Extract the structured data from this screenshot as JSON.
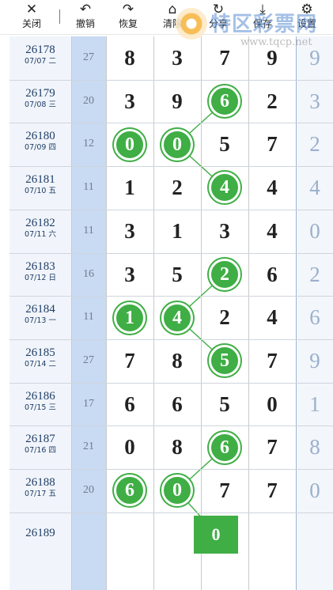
{
  "toolbar": {
    "close": "关闭",
    "undo": "撤销",
    "redo": "恢复",
    "clear": "清除",
    "share": "分享",
    "save": "保存",
    "settings": "设置"
  },
  "watermark": {
    "brand": "特区彩票网",
    "url": "www.tqcp.net"
  },
  "rows": [
    {
      "issue": "26178",
      "date": "07/07 二",
      "sum": "27",
      "digits": [
        "8",
        "3",
        "7",
        "9"
      ],
      "last": "9",
      "hits": []
    },
    {
      "issue": "26179",
      "date": "07/08 三",
      "sum": "20",
      "digits": [
        "3",
        "9",
        "6",
        "2"
      ],
      "last": "3",
      "hits": [
        2
      ]
    },
    {
      "issue": "26180",
      "date": "07/09 四",
      "sum": "12",
      "digits": [
        "0",
        "0",
        "5",
        "7"
      ],
      "last": "2",
      "hits": [
        0,
        1
      ]
    },
    {
      "issue": "26181",
      "date": "07/10 五",
      "sum": "11",
      "digits": [
        "1",
        "2",
        "4",
        "4"
      ],
      "last": "4",
      "hits": [
        2
      ]
    },
    {
      "issue": "26182",
      "date": "07/11 六",
      "sum": "11",
      "digits": [
        "3",
        "1",
        "3",
        "4"
      ],
      "last": "0",
      "hits": []
    },
    {
      "issue": "26183",
      "date": "07/12 日",
      "sum": "16",
      "digits": [
        "3",
        "5",
        "2",
        "6"
      ],
      "last": "2",
      "hits": [
        2
      ]
    },
    {
      "issue": "26184",
      "date": "07/13 一",
      "sum": "11",
      "digits": [
        "1",
        "4",
        "2",
        "4"
      ],
      "last": "6",
      "hits": [
        0,
        1
      ]
    },
    {
      "issue": "26185",
      "date": "07/14 二",
      "sum": "27",
      "digits": [
        "7",
        "8",
        "5",
        "7"
      ],
      "last": "9",
      "hits": [
        2
      ]
    },
    {
      "issue": "26186",
      "date": "07/15 三",
      "sum": "17",
      "digits": [
        "6",
        "6",
        "5",
        "0"
      ],
      "last": "1",
      "hits": []
    },
    {
      "issue": "26187",
      "date": "07/16 四",
      "sum": "21",
      "digits": [
        "0",
        "8",
        "6",
        "7"
      ],
      "last": "8",
      "hits": [
        2
      ]
    },
    {
      "issue": "26188",
      "date": "07/17 五",
      "sum": "20",
      "digits": [
        "6",
        "0",
        "7",
        "7"
      ],
      "last": "0",
      "hits": [
        0,
        1
      ]
    }
  ],
  "pending": {
    "issue": "26189",
    "value": "0"
  },
  "colors": {
    "ball": "#3fae45",
    "sum_col": "#c9daf3",
    "issue_text": "#1f3d66",
    "last_col_text": "#9ab0cb"
  }
}
